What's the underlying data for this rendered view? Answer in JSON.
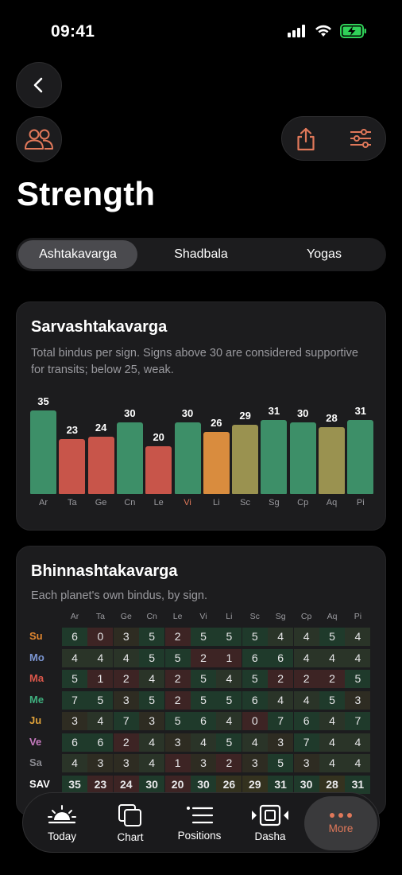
{
  "status": {
    "time": "09:41"
  },
  "title": "Strength",
  "tabs": [
    "Ashtakavarga",
    "Shadbala",
    "Yogas"
  ],
  "sarva": {
    "title": "Sarvashtakavarga",
    "subtitle": "Total bindus per sign. Signs above 30 are considered supportive for transits; below 25, weak."
  },
  "chart_data": {
    "type": "bar",
    "categories": [
      "Ar",
      "Ta",
      "Ge",
      "Cn",
      "Le",
      "Vi",
      "Li",
      "Sc",
      "Sg",
      "Cp",
      "Aq",
      "Pi"
    ],
    "values": [
      35,
      23,
      24,
      30,
      20,
      30,
      26,
      29,
      31,
      30,
      28,
      31
    ],
    "highlighted_category": "Vi",
    "ylim": [
      0,
      40
    ],
    "colors": {
      "strong": "#3d8f68",
      "weak": "#c8554a",
      "moderate": "#d98c3e",
      "neutral": "#9a9250"
    }
  },
  "bhinna": {
    "title": "Bhinnashtakavarga",
    "subtitle": "Each planet's own bindus, by sign.",
    "signs": [
      "Ar",
      "Ta",
      "Ge",
      "Cn",
      "Le",
      "Vi",
      "Li",
      "Sc",
      "Sg",
      "Cp",
      "Aq",
      "Pi"
    ],
    "rows": [
      {
        "planet": "Su",
        "color": "#e0862f",
        "values": [
          6,
          0,
          3,
          5,
          2,
          5,
          5,
          5,
          4,
          4,
          5,
          4
        ]
      },
      {
        "planet": "Mo",
        "color": "#7b95d1",
        "values": [
          4,
          4,
          4,
          5,
          5,
          2,
          1,
          6,
          6,
          4,
          4,
          4
        ]
      },
      {
        "planet": "Ma",
        "color": "#d9564a",
        "values": [
          5,
          1,
          2,
          4,
          2,
          5,
          4,
          5,
          2,
          2,
          2,
          5
        ]
      },
      {
        "planet": "Me",
        "color": "#3fae7e",
        "values": [
          7,
          5,
          3,
          5,
          2,
          5,
          5,
          6,
          4,
          4,
          5,
          3
        ]
      },
      {
        "planet": "Ju",
        "color": "#e0a23a",
        "values": [
          3,
          4,
          7,
          3,
          5,
          6,
          4,
          0,
          7,
          6,
          4,
          7
        ]
      },
      {
        "planet": "Ve",
        "color": "#c77bc0",
        "values": [
          6,
          6,
          2,
          4,
          3,
          4,
          5,
          4,
          3,
          7,
          4,
          4
        ]
      },
      {
        "planet": "Sa",
        "color": "#8a8a90",
        "values": [
          4,
          3,
          3,
          4,
          1,
          3,
          2,
          3,
          5,
          3,
          4,
          4
        ]
      }
    ],
    "sav": {
      "label": "SAV",
      "values": [
        35,
        23,
        24,
        30,
        20,
        30,
        26,
        29,
        31,
        30,
        28,
        31
      ]
    }
  },
  "tabbar": [
    {
      "label": "Today",
      "icon": "sunrise-icon"
    },
    {
      "label": "Chart",
      "icon": "chart-squares-icon"
    },
    {
      "label": "Positions",
      "icon": "list-icon"
    },
    {
      "label": "Dasha",
      "icon": "timeline-icon"
    },
    {
      "label": "More",
      "icon": "more-dots-icon"
    }
  ],
  "accent": "#e0785a"
}
